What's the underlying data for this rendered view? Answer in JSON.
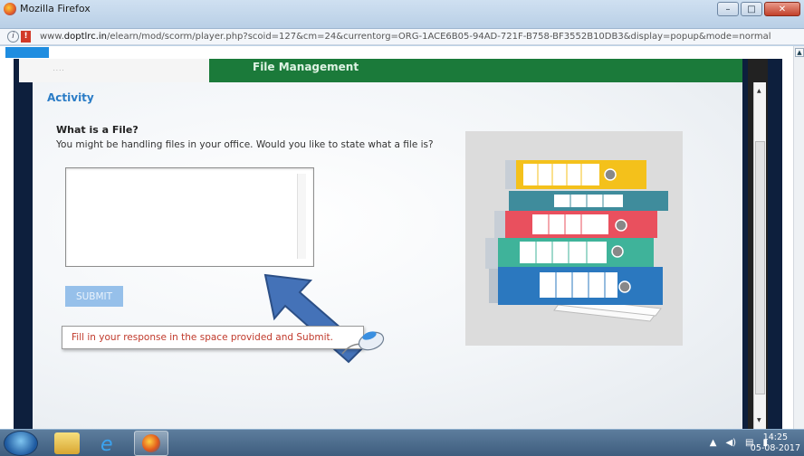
{
  "window": {
    "title": "Mozilla Firefox",
    "buttons": {
      "minimize": "–",
      "maximize": "□",
      "close": "✕"
    }
  },
  "urlbar": {
    "url_prefix": "www.",
    "url_host": "doptlrc.in",
    "url_path": "/elearn/mod/scorm/player.php?scoid=127&cm=24&currentorg=ORG-1ACE6B05-94AD-721F-B758-BF3552B10DB3&display=popup&mode=normal"
  },
  "player": {
    "header_title": "File Management"
  },
  "slide": {
    "section_title": "Activity",
    "question_title": "What is a File?",
    "question_text": "You might be handling files in your office. Would you like to state what a file is?",
    "answer_value": "",
    "submit_label": "SUBMIT",
    "hint_text": "Fill in your response in the space provided and Submit."
  },
  "taskbar": {
    "time": "14:25",
    "date": "05-08-2017"
  },
  "colors": {
    "accent_blue": "#2a7cc6",
    "arrow_blue": "#4472b8",
    "hint_red": "#c0392b",
    "header_green": "#1b7a3a",
    "submit_disabled": "#96c0ea"
  }
}
